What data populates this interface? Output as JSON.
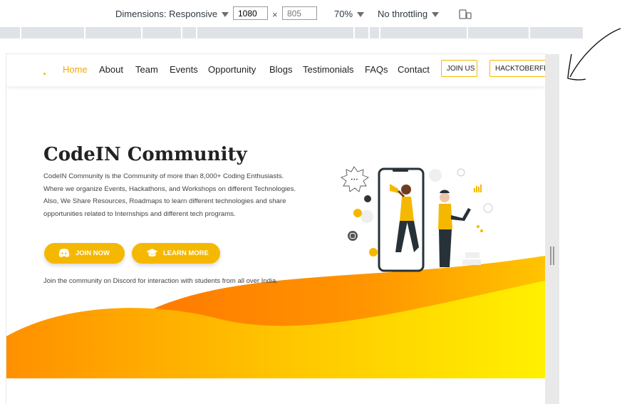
{
  "devtools": {
    "dimensions_label": "Dimensions: Responsive",
    "width_value": "1080",
    "times_sign": "×",
    "height_value": "805",
    "zoom": "70%",
    "throttling": "No throttling"
  },
  "nav": {
    "items": [
      "Home",
      "About",
      "Team",
      "Events",
      "Opportunity",
      "Blogs",
      "Testimonials",
      "FAQs",
      "Contact"
    ],
    "join_label": "JOIN US",
    "hacktoberfest_label": "HACKTOBERFEST"
  },
  "hero": {
    "title": "CodeIN Community",
    "description": "CodeIN Community is the Community of more than 8,000+ Coding Enthusiasts. Where we organize Events, Hackathons, and Workshops on different Technologies. Also, We Share Resources, Roadmaps to learn different technologies and share opportunities related to Internships and different tech programs.",
    "join_now_label": "JOIN NOW",
    "learn_more_label": "LEARN MORE",
    "note": "Join the community on Discord for interaction with students from all over India."
  },
  "colors": {
    "accent": "#f5b800",
    "active_nav": "#f5a800",
    "wave_orange": "#ff8a00",
    "wave_yellow": "#ffe100"
  },
  "icons": [
    "device-toggle-icon",
    "discord-icon",
    "graduation-cap-icon",
    "arrow-annotation-icon",
    "resize-grip-icon"
  ]
}
